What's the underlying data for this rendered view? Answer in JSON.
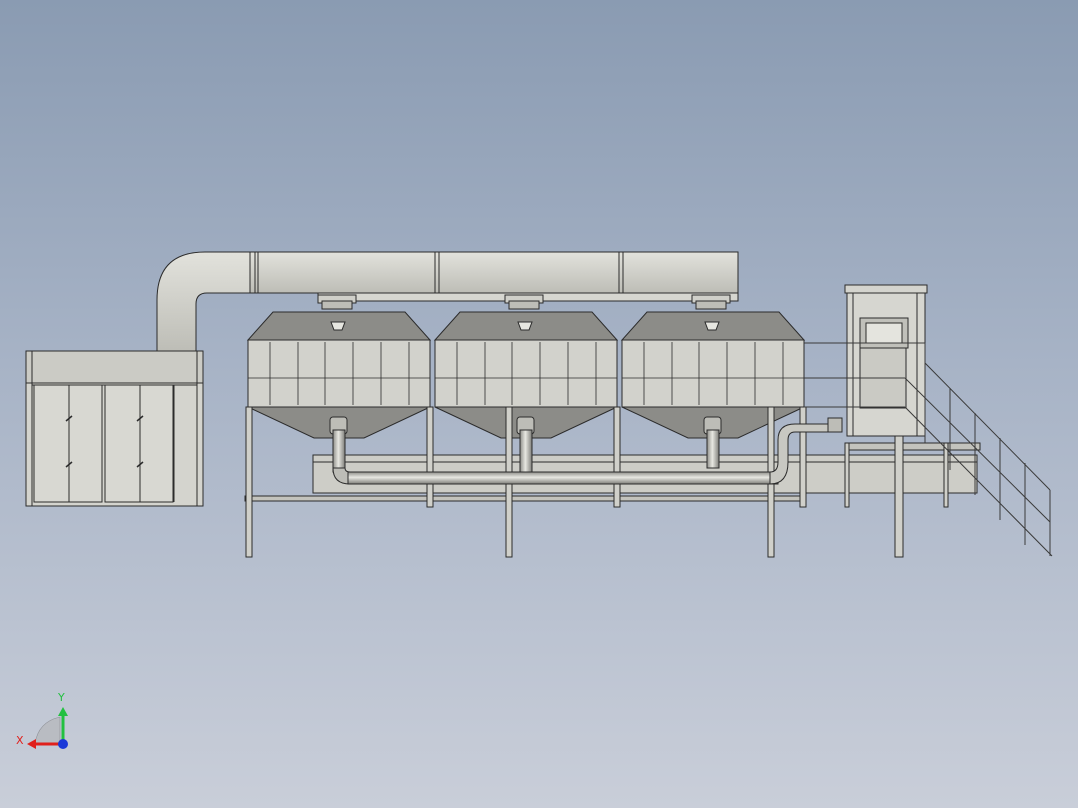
{
  "viewport": {
    "background_top": "#8a9bb2",
    "background_bottom": "#c9ced9"
  },
  "model": {
    "description_icon": "cad-assembly-front-view",
    "body_color": "#cfcfc9",
    "shade_color": "#9b9b96",
    "hopper_color": "#8c8c88",
    "line_color": "#2b2b2b",
    "hopper_count": 3
  },
  "triad": {
    "x_label": "X",
    "y_label": "Y",
    "x_color": "#e0201c",
    "y_color": "#22c040",
    "z_color": "#1a38d8"
  }
}
